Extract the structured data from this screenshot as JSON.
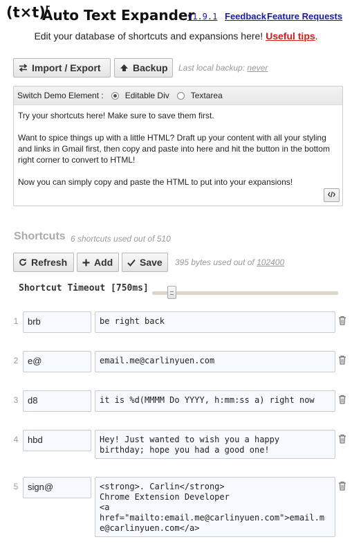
{
  "header": {
    "logo": "(t×t)",
    "logo_sup": "r",
    "title": "Auto Text Expander",
    "version": "v1.9.1",
    "feedback_link": "Feedback",
    "feature_link": "Feature Requests",
    "subtitle": "Edit your database of shortcuts and expansions here!",
    "tips_link": "Useful tips",
    "tips_suffix": "."
  },
  "toolbar": {
    "import_export_label": "Import / Export",
    "backup_label": "Backup",
    "last_backup_prefix": "Last local backup: ",
    "last_backup_value": "never"
  },
  "demo": {
    "switch_label": "Switch Demo Element :",
    "option_editable": "Editable Div",
    "option_textarea": "Textarea",
    "selected": "Editable Div",
    "paragraphs": [
      "Try your shortcuts here! Make sure to save them first.",
      "Want to spice things up with a little HTML? Draft up your content with all your styling and links in Gmail first, then copy and paste into here and hit the button in the bottom right corner to convert to HTML!",
      "Now you can simply copy and paste the HTML to put into your expansions!"
    ]
  },
  "shortcuts_section": {
    "title": "Shortcuts",
    "count_text": "6 shortcuts used out of 510",
    "refresh_label": "Refresh",
    "add_label": "Add",
    "save_label": "Save",
    "bytes_prefix": "395 bytes used out of ",
    "bytes_max": "102400",
    "timeout_label": "Shortcut Timeout [750ms]",
    "timeout_fraction": 0.08
  },
  "shortcuts": [
    {
      "num": "1",
      "shortcut": "brb",
      "expansion": "be right back"
    },
    {
      "num": "2",
      "shortcut": "e@",
      "expansion": "email.me@carlinyuen.com"
    },
    {
      "num": "3",
      "shortcut": "d8",
      "expansion": "it is %d(MMMM Do YYYY, h:mm:ss a) right now"
    },
    {
      "num": "4",
      "shortcut": "hbd",
      "expansion": "Hey! Just wanted to wish you a happy\nbirthday; hope you had a good one!"
    },
    {
      "num": "5",
      "shortcut": "sign@",
      "expansion": "<strong>. Carlin</strong>\nChrome Extension Developer\n<a\nhref=\"mailto:email.me@carlinyuen.com\">email.m\ne@carlinyuen.com</a>"
    }
  ],
  "colors": {
    "link": "#1a1aa6",
    "tips": "#d91c1c",
    "field_bg": "#f6f9fd"
  }
}
